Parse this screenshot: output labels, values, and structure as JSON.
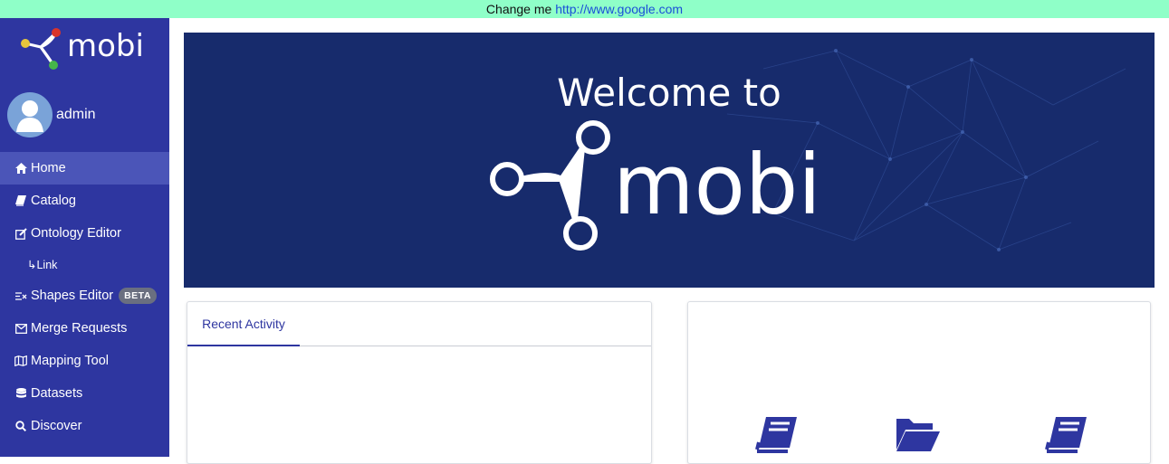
{
  "banner": {
    "text": "Change me",
    "link": "http://www.google.com",
    "background": "#8fffc8"
  },
  "sidebar": {
    "background": "#2e36a0",
    "logo_text": "mobi",
    "user": {
      "name": "admin"
    },
    "items": [
      {
        "label": "Home",
        "icon": "home-icon",
        "active": true
      },
      {
        "label": "Catalog",
        "icon": "book-icon"
      },
      {
        "label": "Ontology Editor",
        "icon": "edit-icon"
      },
      {
        "label": "Link",
        "icon": "sub-arrow-icon",
        "sub": true
      },
      {
        "label": "Shapes Editor",
        "icon": "shapes-icon",
        "badge": "BETA"
      },
      {
        "label": "Merge Requests",
        "icon": "envelope-icon"
      },
      {
        "label": "Mapping Tool",
        "icon": "map-icon"
      },
      {
        "label": "Datasets",
        "icon": "database-icon"
      },
      {
        "label": "Discover",
        "icon": "search-icon"
      }
    ]
  },
  "hero": {
    "title": "Welcome to",
    "logo_text": "mobi",
    "background": "#172b6c"
  },
  "activity": {
    "tab_label": "Recent Activity"
  },
  "quick_actions": {
    "icons": [
      "book-icon",
      "folder-open-icon",
      "book-icon"
    ],
    "color": "#2e36a0"
  }
}
